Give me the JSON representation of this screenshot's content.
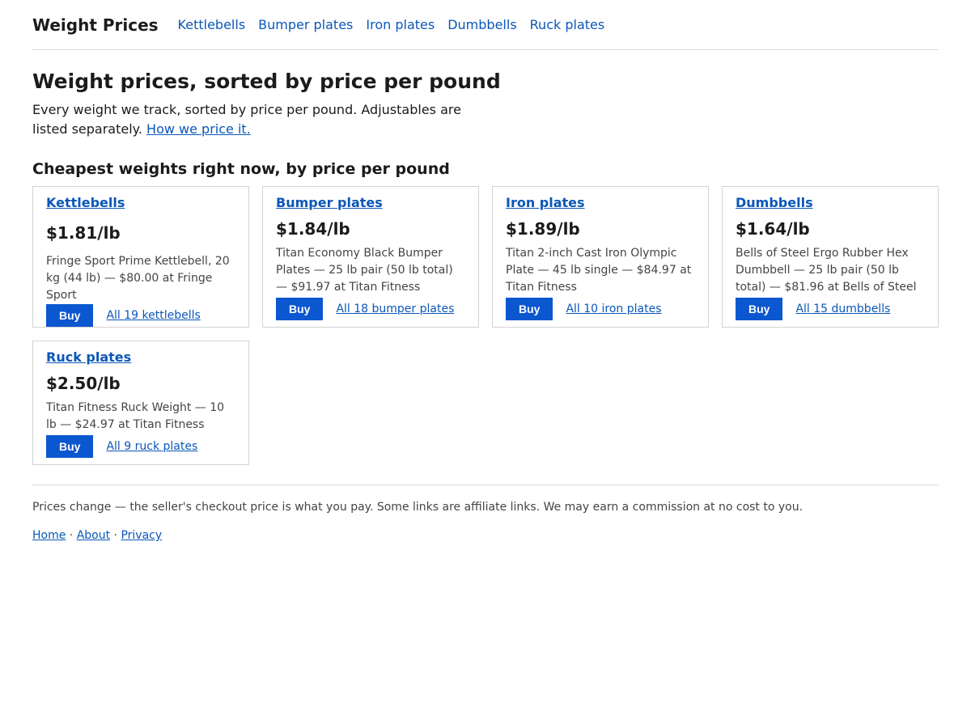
{
  "header": {
    "brand": "Weight Prices",
    "nav": [
      {
        "label": "Kettlebells"
      },
      {
        "label": "Bumper plates"
      },
      {
        "label": "Iron plates"
      },
      {
        "label": "Dumbbells"
      },
      {
        "label": "Ruck plates"
      }
    ]
  },
  "intro": {
    "title": "Weight prices, sorted by price per pound",
    "lead": "Every weight we track, sorted by price per pound. Adjustables are listed separately.",
    "lead_link": "How we price it."
  },
  "section": {
    "title": "Cheapest weights right now, by price per pound"
  },
  "cards": [
    {
      "category": "Kettlebells",
      "price": "$1.81/lb",
      "description": "Fringe Sport Prime Kettlebell, 20 kg (44 lb) — $80.00 at Fringe Sport",
      "buy_label": "Buy",
      "all_label": "All 19 kettlebells"
    },
    {
      "category": "Bumper plates",
      "price": "$1.84/lb",
      "description": "Titan Economy Black Bumper Plates — 25 lb pair (50 lb total) — $91.97 at Titan Fitness",
      "buy_label": "Buy",
      "all_label": "All 18 bumper plates"
    },
    {
      "category": "Iron plates",
      "price": "$1.89/lb",
      "description": "Titan 2-inch Cast Iron Olympic Plate — 45 lb single — $84.97 at Titan Fitness",
      "buy_label": "Buy",
      "all_label": "All 10 iron plates"
    },
    {
      "category": "Dumbbells",
      "price": "$1.64/lb",
      "description": "Bells of Steel Ergo Rubber Hex Dumbbell — 25 lb pair (50 lb total) — $81.96 at Bells of Steel",
      "buy_label": "Buy",
      "all_label": "All 15 dumbbells"
    },
    {
      "category": "Ruck plates",
      "price": "$2.50/lb",
      "description": "Titan Fitness Ruck Weight — 10 lb — $24.97 at Titan Fitness",
      "buy_label": "Buy",
      "all_label": "All 9 ruck plates"
    }
  ],
  "footer": {
    "disclaimer": "Prices change — the seller's checkout price is what you pay. Some links are affiliate links. We may earn a commission at no cost to you.",
    "links": [
      {
        "label": "Home"
      },
      {
        "label": "About"
      },
      {
        "label": "Privacy"
      }
    ],
    "separator": "·"
  },
  "colors": {
    "link": "#0b57b8",
    "button": "#0b57d0",
    "border": "#d3d3d3",
    "text": "#1b1b1b",
    "muted_text": "#444444"
  }
}
